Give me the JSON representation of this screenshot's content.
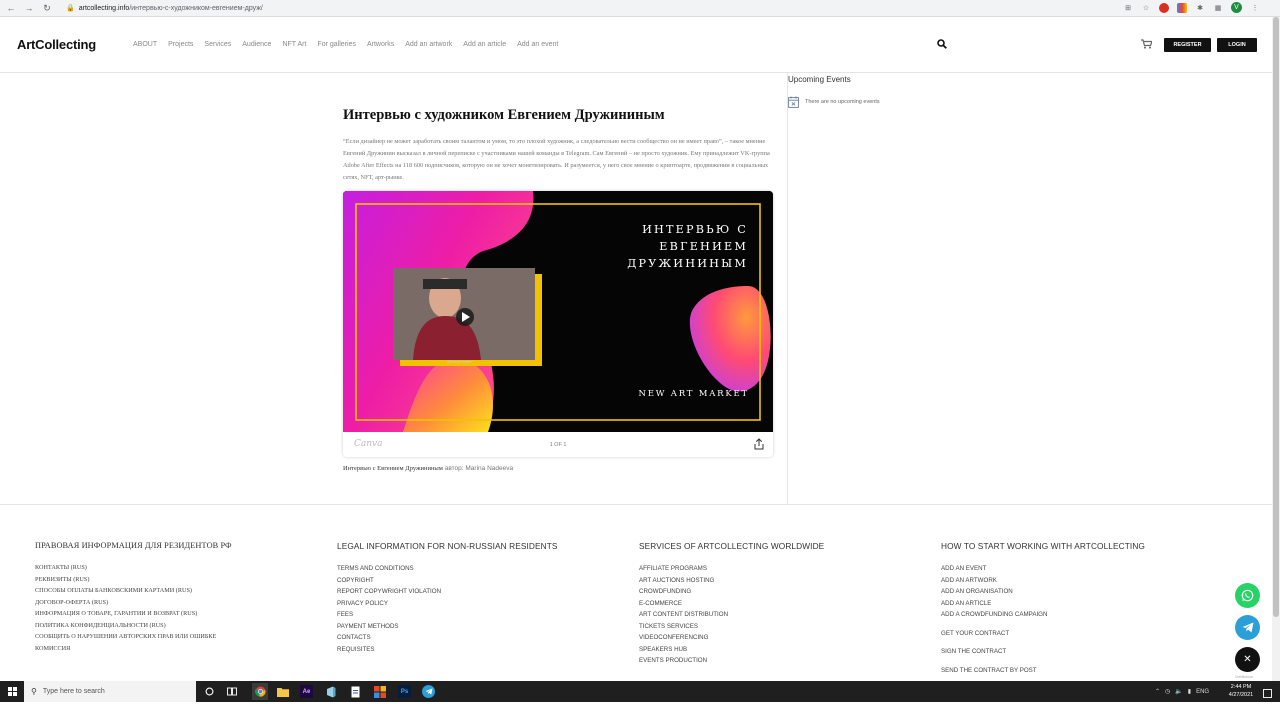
{
  "browser": {
    "url_host": "artcollecting.info",
    "url_path": "/интервью-с-художником-евгением-друж/",
    "avatar_letter": "V"
  },
  "header": {
    "logo": "ArtCollecting",
    "menu": [
      "ABOUT",
      "Projects",
      "Services",
      "Audience",
      "NFT Art",
      "For galleries",
      "Artworks",
      "Add an artwork",
      "Add an article",
      "Add an event"
    ],
    "register_label": "REGISTER",
    "login_label": "LOGIN"
  },
  "article": {
    "title": "Интервью с художником Евгением Дружининым",
    "lead": "“Если дизайнер не может заработать своим талантом и умом, то это плохой художник, а следовательно вести сообщество он не имеет право”, – такое мнение Евгений Дружинин высказал в личной переписке с участниками нашей команды в Telegram. Сам Евгений – не просто художник. Ему принадлежит VK-группа Adobe After Effects на 118 600 подписчиков, которую он не хочет монетизировать. И разумеется, у него свое мнение о криптоарте, продвижении в социальных сетях, NFT, арт-рынке.",
    "embed": {
      "heading_line1": "ИНТЕРВЬЮ С",
      "heading_line2": "ЕВГЕНИЕМ ДРУЖИНИНЫМ",
      "tagline": "NEW ART MARKET",
      "brand": "Canva",
      "pager": "1 OF 1"
    },
    "caption_title": "Интервью с Евгением Дружининым",
    "caption_author": "автор: Marina Nadeeva"
  },
  "sidebar": {
    "title": "Upcoming Events",
    "empty_text": "There are no upcoming events"
  },
  "footer": {
    "columns": [
      {
        "heading": "ПРАВОВАЯ ИНФОРМАЦИЯ ДЛЯ РЕЗИДЕНТОВ РФ",
        "items": [
          "КОНТАКТЫ (RUS)",
          "РЕКВИЗИТЫ (RUS)",
          "СПОСОБЫ ОПЛАТЫ БАНКОВСКИМИ КАРТАМИ (RUS)",
          "ДОГОВОР-ОФЕРТА (RUS)",
          "ИНФОРМАЦИЯ О ТОВАРЕ, ГАРАНТИИ И ВОЗВРАТ (RUS)",
          "ПОЛИТИКА КОНФИДЕНЦИАЛЬНОСТИ (RUS)",
          "СООБЩИТЬ О НАРУШЕНИИ АВТОРСКИХ ПРАВ ИЛИ ОШИБКЕ",
          "КОМИССИЯ"
        ]
      },
      {
        "heading": "LEGAL INFORMATION FOR NON-RUSSIAN RESIDENTS",
        "items": [
          "TERMS AND CONDITIONS",
          "COPYRIGHT",
          "REPORT COPYWRIGHT VIOLATION",
          "PRIVACY POLICY",
          "FEES",
          "PAYMENT METHODS",
          "CONTACTS",
          "REQUISITES"
        ]
      },
      {
        "heading": "SERVICES OF ARTCOLLECTING WORLDWIDE",
        "items": [
          "AFFILIATE PROGRAMS",
          "ART AUCTIONS HOSTING",
          "CROWDFUNDING",
          "E-COMMERCE",
          "ART CONTENT DISTRIBUTION",
          "TICKETS SERVICES",
          "VIDEOCONFERENCING",
          "SPEAKERS HUB",
          "EVENTS PRODUCTION"
        ]
      },
      {
        "heading": "HOW TO START WORKING WITH ARTCOLLECTING",
        "items": [
          "ADD AN EVENT",
          "ADD AN ARTWORK",
          "ADD AN ORGANISATION",
          "ADD AN ARTICLE",
          "ADD A CROWDFUNDING CAMPAIGN",
          "GET YOUR CONTRACT",
          "SIGN THE CONTRACT",
          "SEND THE CONTRACT BY POST"
        ]
      }
    ]
  },
  "widgets": {
    "getbutton": "GetButton"
  },
  "taskbar": {
    "search_placeholder": "Type here to search",
    "lang": "ENG",
    "time": "2:44 PM",
    "date": "4/27/2021"
  }
}
